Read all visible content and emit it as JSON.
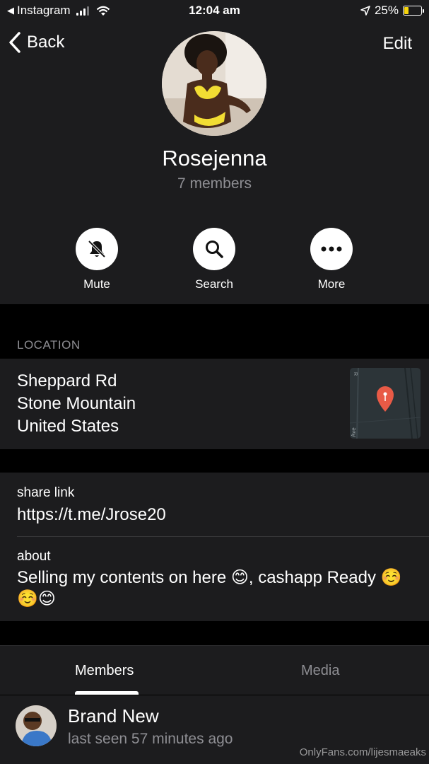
{
  "status_bar": {
    "carrier": "Instagram",
    "time": "12:04 am",
    "battery": "25%",
    "battery_level": 0.25
  },
  "header": {
    "back_label": "Back",
    "edit_label": "Edit",
    "name": "Rosejenna",
    "subtitle": "7 members"
  },
  "actions": [
    {
      "label": "Mute",
      "icon": "bell-slash-icon"
    },
    {
      "label": "Search",
      "icon": "magnifier-icon"
    },
    {
      "label": "More",
      "icon": "ellipsis-icon"
    }
  ],
  "location": {
    "section_label": "LOCATION",
    "lines": [
      "Sheppard Rd",
      "Stone Mountain",
      "United States"
    ],
    "map_labels": [
      "R",
      "Ave"
    ]
  },
  "info": {
    "share_label": "share link",
    "share_value": "https://t.me/Jrose20",
    "about_label": "about",
    "about_value": "Selling my contents on here 😊, cashapp Ready ☺️☺️😊"
  },
  "tabs": [
    "Members",
    "Media"
  ],
  "members": [
    {
      "name": "Brand New",
      "status": "last seen 57 minutes ago"
    }
  ],
  "watermark": "OnlyFans.com/lijesmaeaks"
}
